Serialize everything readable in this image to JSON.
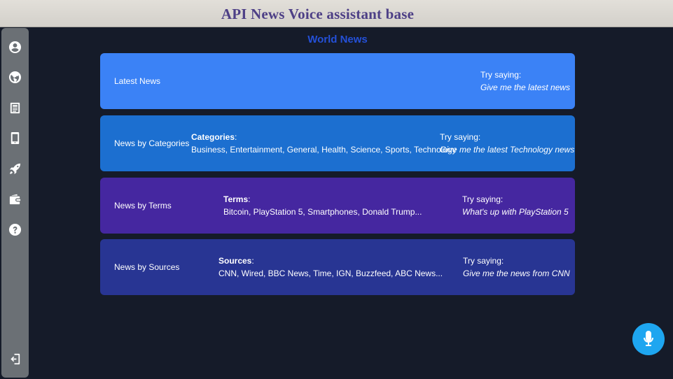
{
  "window": {
    "title": "API News Voice assistant base"
  },
  "sidebar": {
    "items": [
      {
        "icon": "user-circle-icon"
      },
      {
        "icon": "globe-icon"
      },
      {
        "icon": "newspaper-icon"
      },
      {
        "icon": "tablet-icon"
      },
      {
        "icon": "rocket-icon"
      },
      {
        "icon": "wallet-icon"
      },
      {
        "icon": "help-icon"
      },
      {
        "icon": "logout-icon"
      }
    ]
  },
  "page": {
    "heading": "World News"
  },
  "cards": [
    {
      "name": "Latest News",
      "info_title": "",
      "info_items": "",
      "try_label": "Try saying:",
      "try_example": "Give me the latest news",
      "color": "#3b82f6"
    },
    {
      "name": "News by Categories",
      "info_title": "Categories",
      "info_items": "Business, Entertainment, General, Health, Science, Sports, Technology",
      "try_label": "Try saying:",
      "try_example": "Give me the latest Technology news",
      "color": "#1c6fd0"
    },
    {
      "name": "News by Terms",
      "info_title": "Terms",
      "info_items": "Bitcoin, PlayStation 5, Smartphones, Donald Trump...",
      "try_label": "Try saying:",
      "try_example": "What's up with PlayStation 5",
      "color": "#4527a0"
    },
    {
      "name": "News by Sources",
      "info_title": "Sources",
      "info_items": "CNN, Wired, BBC News, Time, IGN, Buzzfeed, ABC News...",
      "try_label": "Try saying:",
      "try_example": "Give me the news from CNN",
      "color": "#283593"
    }
  ],
  "mic_button": {
    "icon": "microphone-icon",
    "color": "#1ea6f0"
  }
}
